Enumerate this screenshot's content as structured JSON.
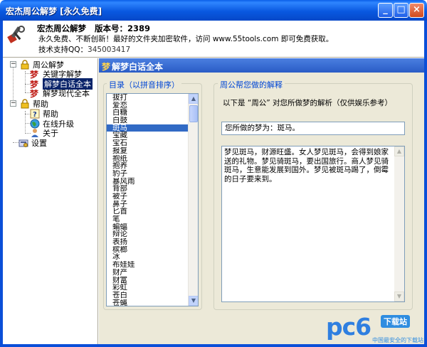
{
  "window": {
    "title": "宏杰周公解梦 [永久免费]",
    "min_label": "_",
    "max_label": "□",
    "close_label": "×"
  },
  "header": {
    "app_name": "宏杰周公解梦",
    "version": "版本号：2389",
    "line2": "永久免费、不断创新！最好的文件夹加密软件，访问 www.55tools.com 即可免费获取。",
    "support_label": "技术支持QQ：",
    "support_qq": "345003417"
  },
  "tree": {
    "root": "周公解梦",
    "children": [
      "关键字解梦",
      "解梦白话全本",
      "解梦现代全本"
    ],
    "help": "帮助",
    "help_children": [
      "帮助",
      "在线升级",
      "关于"
    ],
    "settings": "设置",
    "selected": "解梦白话全本"
  },
  "panel": {
    "title": "解梦白话全本",
    "directory_label": "目录（以拼音排序）",
    "analysis_label": "周公帮您做的解释",
    "description": "以下是 “周公” 对您所做梦的解析（仅供娱乐参考）",
    "dream_label": "您所做的梦为：斑马。",
    "result": "梦见斑马，财源旺盛。女人梦见斑马，会得到娘家送的礼物。梦见骑斑马，要出国旅行。商人梦见骑斑马，生意能发展到国外。梦见被斑马踢了，倒霉的日子要来到。"
  },
  "list": {
    "items": [
      "拔打",
      "爱恋",
      "白糖",
      "白鼓",
      "斑马",
      "宝藏",
      "宝石",
      "报复",
      "抱纸",
      "抱养",
      "豹子",
      "暴风雨",
      "背部",
      "被子",
      "鼻子",
      "匕首",
      "笔",
      "蝙蝠",
      "辩论",
      "表扬",
      "槟榔",
      "冰",
      "布娃娃",
      "财产",
      "财富",
      "彩虹",
      "苍白",
      "苍蝇"
    ],
    "selected_index": 4
  },
  "watermark": {
    "brand": "pc6",
    "badge": "下载站",
    "sub": "中国最安全的下载站"
  }
}
